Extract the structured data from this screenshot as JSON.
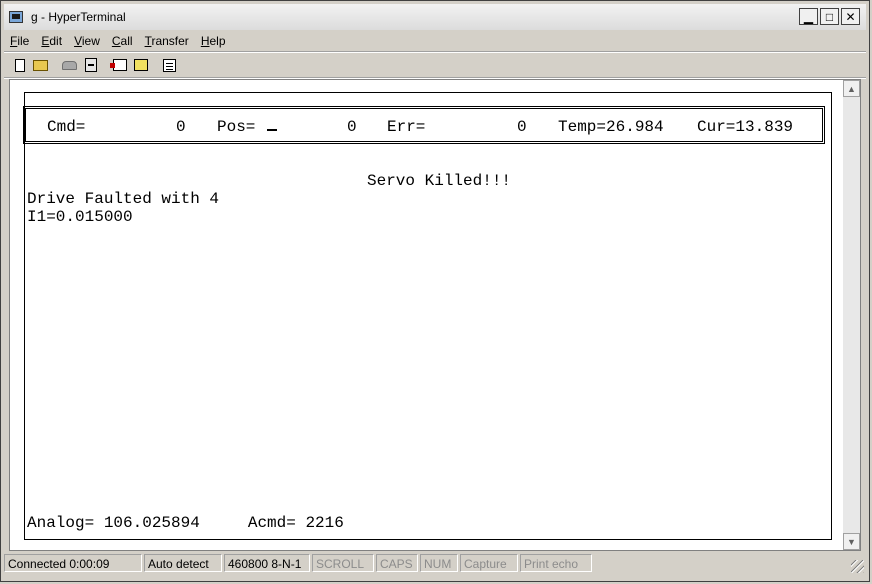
{
  "window": {
    "title": "g - HyperTerminal"
  },
  "menu": [
    {
      "key": "F",
      "rest": "ile"
    },
    {
      "key": "E",
      "rest": "dit"
    },
    {
      "key": "V",
      "rest": "iew"
    },
    {
      "key": "C",
      "rest": "all"
    },
    {
      "key": "T",
      "rest": "ransfer"
    },
    {
      "key": "H",
      "rest": "elp"
    }
  ],
  "toolbar": {
    "icons": [
      "new-icon",
      "open-icon",
      "disconnect-phone-icon",
      "dial-icon",
      "send-icon",
      "receive-icon",
      "properties-icon"
    ]
  },
  "terminal": {
    "header": {
      "cmd_label": "Cmd=",
      "cmd_value": "0",
      "pos_label": "Pos=",
      "pos_value": "0",
      "err_label": "Err=",
      "err_value": "0",
      "temp": "Temp=26.984",
      "cur": "Cur=13.839"
    },
    "message": "Servo Killed!!!",
    "line1": "Drive Faulted with 4",
    "line2": "I1=0.015000",
    "footer": "Analog= 106.025894     Acmd= 2216"
  },
  "status": {
    "connected": "Connected 0:00:09",
    "detect": "Auto detect",
    "settings": "460800 8-N-1",
    "scroll": "SCROLL",
    "caps": "CAPS",
    "num": "NUM",
    "capture": "Capture",
    "print_echo": "Print echo"
  }
}
